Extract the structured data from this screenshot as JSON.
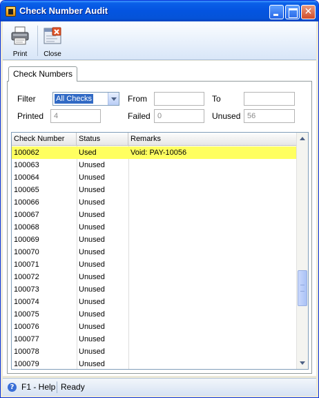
{
  "window": {
    "title": "Check Number Audit"
  },
  "toolbar": {
    "print_label": "Print",
    "close_label": "Close"
  },
  "tabs": [
    {
      "label": "Check Numbers"
    }
  ],
  "filters": {
    "filter_label": "Filter",
    "filter_value": "All Checks",
    "from_label": "From",
    "from_value": "",
    "to_label": "To",
    "to_value": "",
    "printed_label": "Printed",
    "printed_value": "4",
    "failed_label": "Failed",
    "failed_value": "0",
    "unused_label": "Unused",
    "unused_value": "56"
  },
  "grid": {
    "columns": [
      "Check Number",
      "Status",
      "Remarks"
    ],
    "selected_row_color": "#ffff60",
    "rows": [
      {
        "number": "100062",
        "status": "Used",
        "remarks": "Void: PAY-10056",
        "selected": true
      },
      {
        "number": "100063",
        "status": "Unused",
        "remarks": ""
      },
      {
        "number": "100064",
        "status": "Unused",
        "remarks": ""
      },
      {
        "number": "100065",
        "status": "Unused",
        "remarks": ""
      },
      {
        "number": "100066",
        "status": "Unused",
        "remarks": ""
      },
      {
        "number": "100067",
        "status": "Unused",
        "remarks": ""
      },
      {
        "number": "100068",
        "status": "Unused",
        "remarks": ""
      },
      {
        "number": "100069",
        "status": "Unused",
        "remarks": ""
      },
      {
        "number": "100070",
        "status": "Unused",
        "remarks": ""
      },
      {
        "number": "100071",
        "status": "Unused",
        "remarks": ""
      },
      {
        "number": "100072",
        "status": "Unused",
        "remarks": ""
      },
      {
        "number": "100073",
        "status": "Unused",
        "remarks": ""
      },
      {
        "number": "100074",
        "status": "Unused",
        "remarks": ""
      },
      {
        "number": "100075",
        "status": "Unused",
        "remarks": ""
      },
      {
        "number": "100076",
        "status": "Unused",
        "remarks": ""
      },
      {
        "number": "100077",
        "status": "Unused",
        "remarks": ""
      },
      {
        "number": "100078",
        "status": "Unused",
        "remarks": ""
      },
      {
        "number": "100079",
        "status": "Unused",
        "remarks": ""
      }
    ]
  },
  "statusbar": {
    "help": "F1 - Help",
    "state": "Ready"
  },
  "icons": {
    "app": "app-icon",
    "print": "printer-icon",
    "close": "close-document-icon",
    "help": "help-icon"
  }
}
